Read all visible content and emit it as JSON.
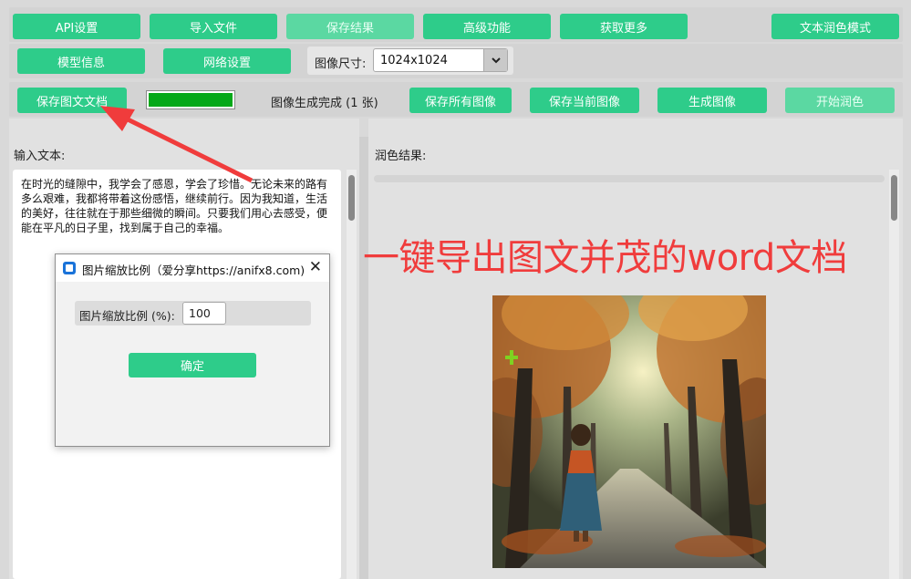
{
  "toolbar_row1": {
    "api_settings": "API设置",
    "import_file": "导入文件",
    "save_result": "保存结果",
    "advanced": "高级功能",
    "get_more": "获取更多",
    "text_polish_mode": "文本润色模式"
  },
  "toolbar_row2": {
    "model_info": "模型信息",
    "network_settings": "网络设置",
    "image_size_label": "图像尺寸:",
    "image_size_value": "1024x1024"
  },
  "toolbar_row3": {
    "save_doc": "保存图文文档",
    "progress": 1.0,
    "status": "图像生成完成 (1 张)",
    "save_all_images": "保存所有图像",
    "save_current_image": "保存当前图像",
    "generate_image": "生成图像",
    "start_polish": "开始润色"
  },
  "left_panel": {
    "label": "输入文本:",
    "text": "在时光的缝隙中，我学会了感恩，学会了珍惜。无论未来的路有多么艰难，我都将带着这份感悟，继续前行。因为我知道，生活的美好，往往就在于那些细微的瞬间。只要我们用心去感受，便能在平凡的日子里，找到属于自己的幸福。"
  },
  "right_panel": {
    "label": "润色结果:"
  },
  "annotation": "一键导出图文并茂的word文档",
  "dialog": {
    "title": "图片缩放比例（爱分享https://anifx8.com)",
    "field_label": "图片缩放比例 (%):",
    "field_value": "100",
    "ok": "确定"
  },
  "colors": {
    "accent": "#2ecc8a",
    "annotation": "#f03c3c",
    "progress": "#05a819"
  }
}
